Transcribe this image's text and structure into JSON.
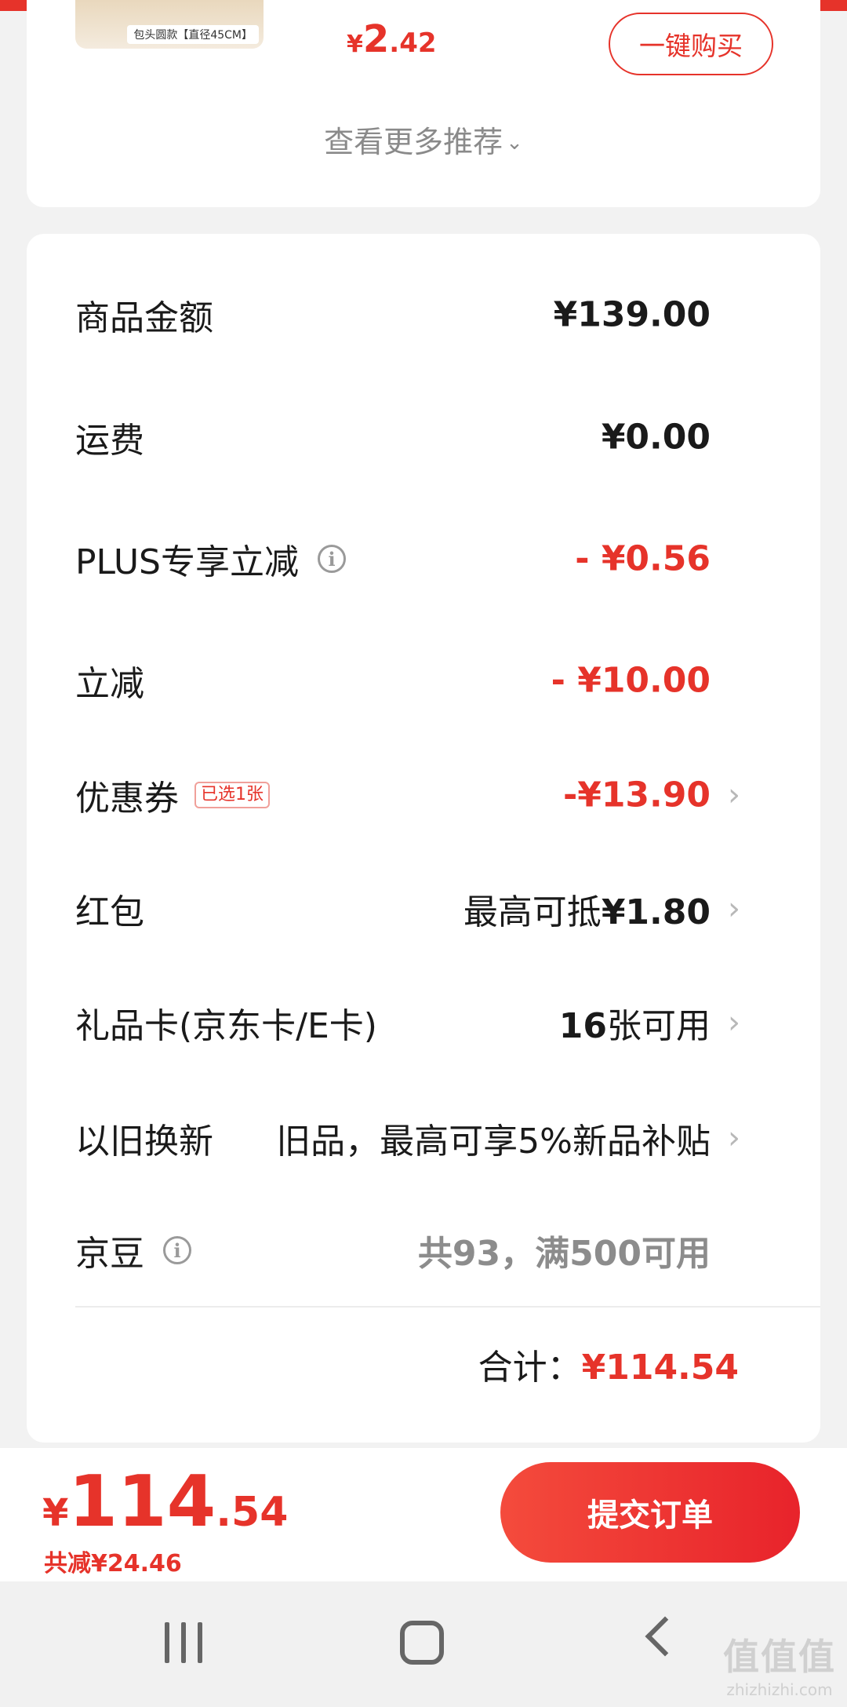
{
  "recommendation": {
    "thumb_label": "包头圆款【直径45CM】",
    "price_symbol": "¥",
    "price_int": "2",
    "price_dec": ".42",
    "buy_button": "一键购买",
    "more_text": "查看更多推荐",
    "more_icon": "chevron-down-icon"
  },
  "summary": {
    "rows": [
      {
        "label": "商品金额",
        "value": "¥139.00"
      },
      {
        "label": "运费",
        "value": "¥0.00"
      },
      {
        "label": "PLUS专享立减",
        "value": "- ¥0.56",
        "info_icon": "info-icon"
      },
      {
        "label": "立减",
        "value": "- ¥10.00"
      },
      {
        "label": "优惠券",
        "badge": "已选1张",
        "value": "-¥13.90"
      },
      {
        "label": "红包",
        "value_prefix": "最高可抵",
        "value": "¥1.80"
      },
      {
        "label": "礼品卡(京东卡/E卡)",
        "value_prefix": "16",
        "value": "张可用"
      },
      {
        "label": "以旧换新",
        "value": "旧品，最高可享5%新品补贴"
      },
      {
        "label": "京豆",
        "value": "共93，满500可用",
        "info_icon": "info-icon"
      }
    ],
    "total_label": "合计：",
    "total_value": "¥114.54"
  },
  "footer": {
    "price_symbol": "¥",
    "price_int": "114",
    "price_dec": ".54",
    "saved": "共减¥24.46",
    "submit": "提交订单"
  },
  "watermark": {
    "big": "值值值",
    "small": "zhizhizhi.com"
  },
  "colors": {
    "accent": "#e6332a",
    "text": "#1a1a1a",
    "muted": "#8c8c8c"
  }
}
